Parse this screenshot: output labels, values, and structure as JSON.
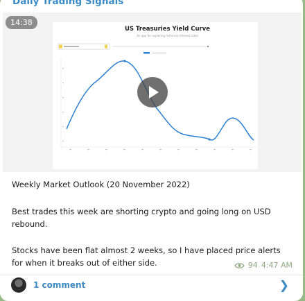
{
  "post": {
    "channel_name": "Daily Trading Signals",
    "video_duration": "14:38",
    "chart_title": "US Treasuries Yield Curve",
    "chart_subtitle": "An app for exploring historical interest rates",
    "paragraph_1": "Weekly Market Outlook (20 November 2022)",
    "paragraph_2": "Best trades this week are shorting crypto and going long on USD rebound.",
    "paragraph_3": "Stocks have been flat almost 2 weeks, so I have placed price alerts for when it breaks out of either side.",
    "views": "94",
    "time": "4:47 AM",
    "comments_label": "1 comment"
  },
  "icons": {
    "views": "eye-icon",
    "play": "play-icon",
    "avatar": "avatar",
    "chevron": "chevron-right-icon"
  },
  "colors": {
    "accent": "#3b8bc5",
    "background": "#97b987",
    "meta": "#8fa882",
    "curve": "#2a7fd0"
  }
}
